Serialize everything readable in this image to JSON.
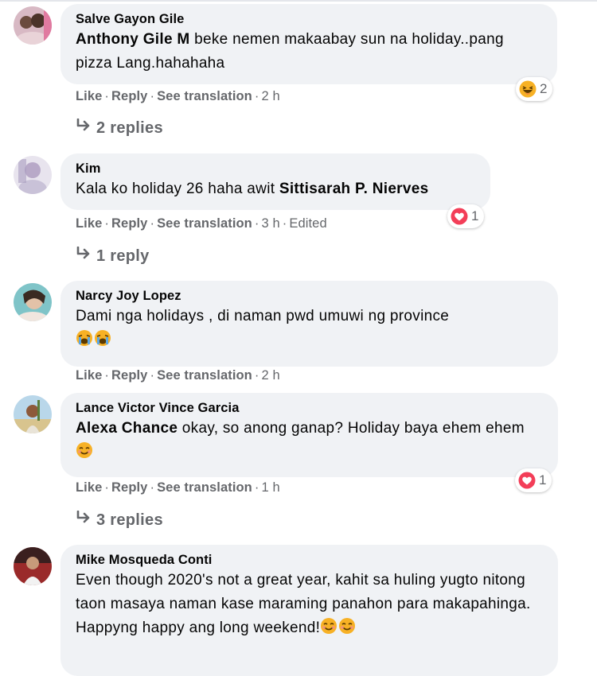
{
  "actions": {
    "like": "Like",
    "reply": "Reply",
    "see_translation": "See translation",
    "dot": "·"
  },
  "colors": {
    "bubble": "#f0f2f5",
    "secondary_text": "#65676b",
    "heart": "#f33e58",
    "haha": "#f7b125"
  },
  "comments": [
    {
      "author": "Salve Gayon Gile",
      "mention": "Anthony Gile M",
      "text": " beke nemen makaabay sun na holiday..pang pizza Lang.hahahaha",
      "time": "2 h",
      "reaction": {
        "icon": "haha-reaction-icon",
        "count": "2"
      },
      "replies": "2 replies"
    },
    {
      "author": "Kim",
      "text": "Kala ko holiday 26 haha awit ",
      "mention_after": "Sittisarah P. Nierves",
      "time": "3 h",
      "edited": "Edited",
      "reaction": {
        "icon": "heart-reaction-icon",
        "count": "1"
      },
      "replies": "1 reply"
    },
    {
      "author": "Narcy Joy Lopez",
      "text": "Dami nga holidays , di naman pwd umuwi ng province",
      "emojis": [
        "crying-face-emoji",
        "crying-face-emoji"
      ],
      "time": "2 h"
    },
    {
      "author": "Lance Victor Vince Garcia",
      "mention": "Alexa Chance",
      "text": " okay, so anong ganap? Holiday baya ehem ehem",
      "emojis": [
        "smiling-face-emoji"
      ],
      "time": "1 h",
      "reaction": {
        "icon": "heart-reaction-icon",
        "count": "1"
      },
      "replies": "3 replies"
    },
    {
      "author": "Mike Mosqueda Conti",
      "text": "Even though 2020's not a great year, kahit sa huling yugto nitong taon masaya naman kase maraming panahon para makapahinga. Happyng happy ang long weekend!",
      "emojis": [
        "smiling-face-emoji",
        "smiling-face-emoji"
      ]
    }
  ]
}
